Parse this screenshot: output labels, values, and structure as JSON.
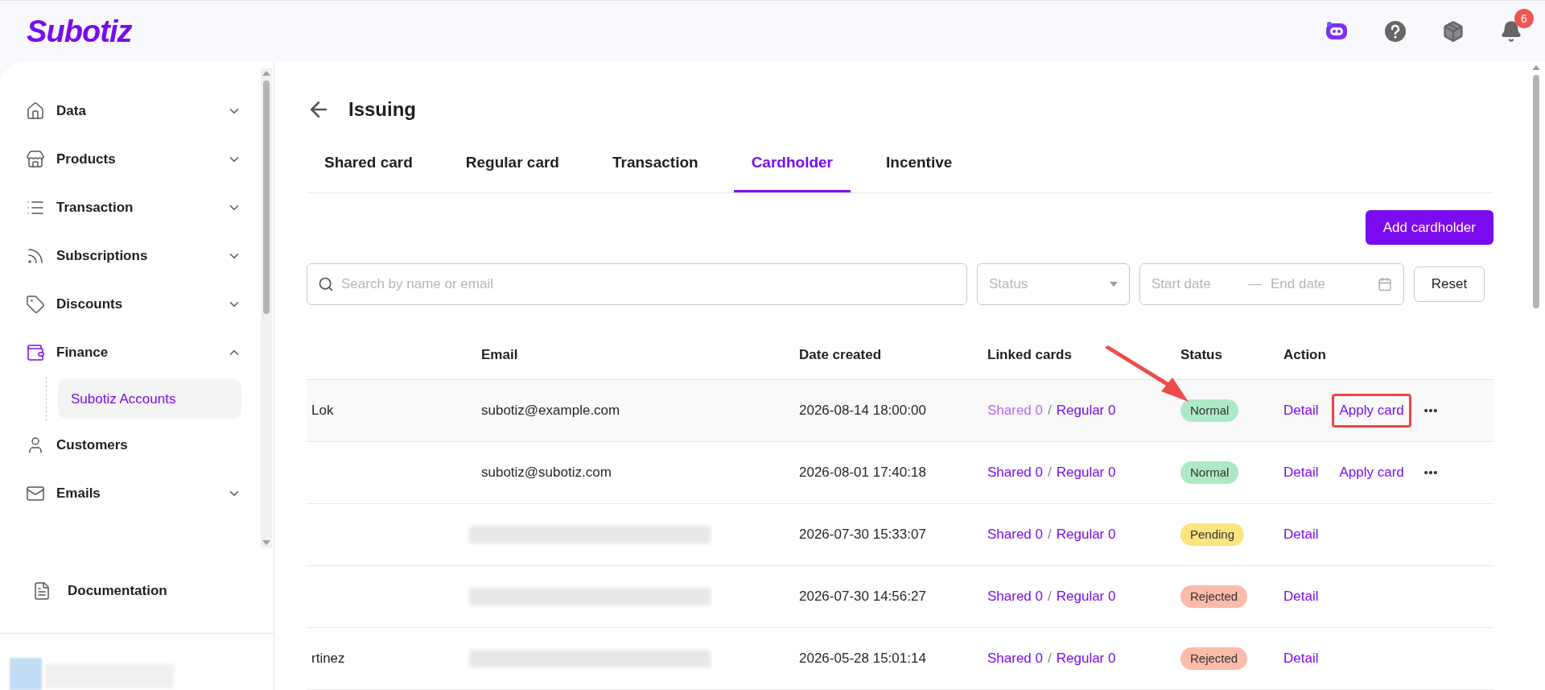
{
  "header": {
    "logo": "Subotiz",
    "notifications": {
      "count": "6"
    }
  },
  "sidebar": {
    "items": [
      {
        "label": "Data",
        "expanded": false,
        "selected": false
      },
      {
        "label": "Products",
        "expanded": false,
        "selected": false
      },
      {
        "label": "Transaction",
        "expanded": false,
        "selected": false
      },
      {
        "label": "Subscriptions",
        "expanded": false,
        "selected": false
      },
      {
        "label": "Discounts",
        "expanded": false,
        "selected": false
      },
      {
        "label": "Finance",
        "expanded": true,
        "selected": true,
        "children": [
          {
            "label": "Subotiz Accounts",
            "selected": true
          }
        ]
      },
      {
        "label": "Customers",
        "selected": false
      },
      {
        "label": "Emails",
        "expanded": false,
        "selected": false
      }
    ],
    "footer_link": "Documentation"
  },
  "page": {
    "title": "Issuing",
    "tabs": [
      {
        "label": "Shared card",
        "selected": false
      },
      {
        "label": "Regular card",
        "selected": false
      },
      {
        "label": "Transaction",
        "selected": false
      },
      {
        "label": "Cardholder",
        "selected": true
      },
      {
        "label": "Incentive",
        "selected": false
      }
    ],
    "primary_button": "Add cardholder",
    "filters": {
      "search": {
        "placeholder": "Search by name or email"
      },
      "status": {
        "placeholder": "Status"
      },
      "start_date": {
        "placeholder": "Start date"
      },
      "date_separator": "—",
      "end_date": {
        "placeholder": "End date"
      },
      "reset": "Reset"
    },
    "table": {
      "columns": [
        "Email",
        "Date created",
        "Linked cards",
        "Status",
        "Action"
      ],
      "rows": [
        {
          "name": "Lok",
          "email": "subotiz@example.com",
          "email_blurred": false,
          "date": "2026-08-14 18:00:00",
          "shared": "Shared 0",
          "separator": "/",
          "regular": "Regular 0",
          "status": {
            "label": "Normal",
            "color": "#aee9c5"
          },
          "hovered": true,
          "actions": [
            {
              "label": "Detail",
              "highlighted": false
            },
            {
              "label": "Apply card",
              "highlighted": true
            }
          ],
          "more_menu": true
        },
        {
          "email": "subotiz@subotiz.com",
          "email_blurred": false,
          "date": "2026-08-01 17:40:18",
          "shared": "Shared 0",
          "separator": "/",
          "regular": "Regular 0",
          "status": {
            "label": "Normal",
            "color": "#aee9c5"
          },
          "hovered": false,
          "actions": [
            {
              "label": "Detail",
              "highlighted": false
            },
            {
              "label": "Apply card",
              "highlighted": false
            }
          ],
          "more_menu": true
        },
        {
          "email_blurred": true,
          "date": "2026-07-30 15:33:07",
          "shared": "Shared 0",
          "separator": "/",
          "regular": "Regular 0",
          "status": {
            "label": "Pending",
            "color": "#fde47f"
          },
          "hovered": false,
          "actions": [
            {
              "label": "Detail",
              "highlighted": false
            }
          ],
          "more_menu": false
        },
        {
          "email_blurred": true,
          "date": "2026-07-30 14:56:27",
          "shared": "Shared 0",
          "separator": "/",
          "regular": "Regular 0",
          "status": {
            "label": "Rejected",
            "color": "#fbbba9"
          },
          "hovered": false,
          "actions": [
            {
              "label": "Detail",
              "highlighted": false
            }
          ],
          "more_menu": false
        },
        {
          "name": "rtinez",
          "email_blurred": true,
          "date": "2026-05-28 15:01:14",
          "shared": "Shared 0",
          "separator": "/",
          "regular": "Regular 0",
          "status": {
            "label": "Rejected",
            "color": "#fbbba9"
          },
          "hovered": false,
          "actions": [
            {
              "label": "Detail",
              "highlighted": false
            }
          ],
          "more_menu": false
        }
      ],
      "annotation_arrow": true
    }
  }
}
